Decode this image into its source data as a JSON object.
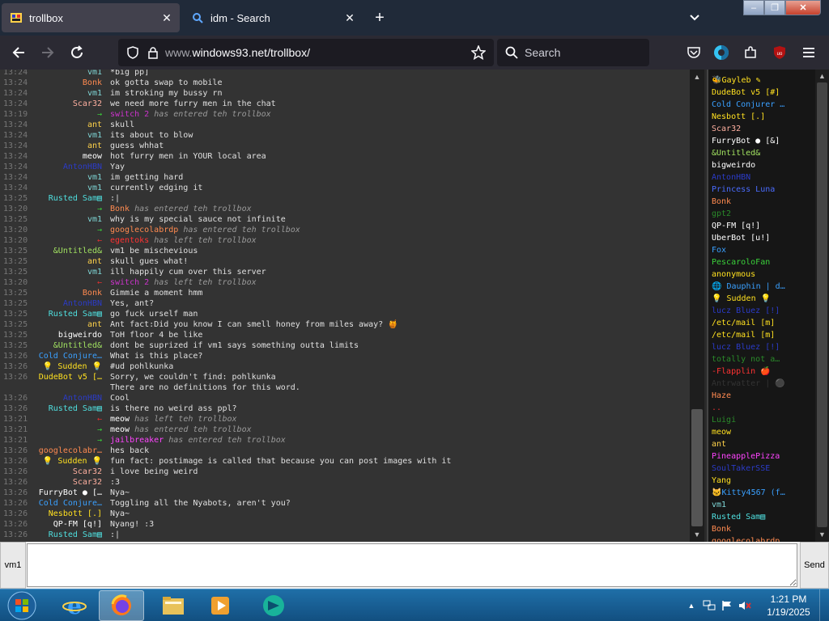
{
  "browser": {
    "tabs": [
      {
        "title": "trollbox",
        "active": true,
        "icon": "win93-icon"
      },
      {
        "title": "idm - Search",
        "active": false,
        "icon": "search-icon"
      }
    ],
    "url_dim": "www.",
    "url_main": "windows93.net/trollbox/",
    "search_placeholder": "Search"
  },
  "chat": {
    "messages": [
      {
        "time": "13:24",
        "nick": "vm1",
        "color": "#7fd7d7",
        "text": "*big pp]"
      },
      {
        "time": "13:24",
        "nick": "Bonk",
        "color": "#ff8a50",
        "text": "ok gotta swap to mobile"
      },
      {
        "time": "13:24",
        "nick": "vm1",
        "color": "#7fd7d7",
        "text": "im stroking my bussy rn"
      },
      {
        "time": "13:24",
        "nick": "Scar32",
        "color": "#ffb0a0",
        "text": "we need more furry men in the chat"
      },
      {
        "time": "13:19",
        "nick": "→",
        "color": "#3ad03a",
        "text": "has entered teh trollbox",
        "event": true,
        "ev_nick": "switch 2",
        "ev_color": "#cc33cc"
      },
      {
        "time": "13:24",
        "nick": "ant",
        "color": "#ffd24a",
        "text": "skull"
      },
      {
        "time": "13:24",
        "nick": "vm1",
        "color": "#7fd7d7",
        "text": "its about to blow"
      },
      {
        "time": "13:24",
        "nick": "ant",
        "color": "#ffd24a",
        "text": "guess whhat"
      },
      {
        "time": "13:24",
        "nick": "meow",
        "color": "#ffffff",
        "text": "hot furry men in YOUR local area"
      },
      {
        "time": "13:24",
        "nick": "AntonHBN",
        "color": "#2b3bc8",
        "text": "Yay"
      },
      {
        "time": "13:24",
        "nick": "vm1",
        "color": "#7fd7d7",
        "text": "im getting hard"
      },
      {
        "time": "13:24",
        "nick": "vm1",
        "color": "#7fd7d7",
        "text": "currently edging it"
      },
      {
        "time": "13:25",
        "nick": "Rusted Sam▤",
        "color": "#4fe0e0",
        "text": ":|"
      },
      {
        "time": "13:20",
        "nick": "→",
        "color": "#3ad03a",
        "text": "has entered teh trollbox",
        "event": true,
        "ev_nick": "Bonk",
        "ev_color": "#ff8a50"
      },
      {
        "time": "13:25",
        "nick": "vm1",
        "color": "#7fd7d7",
        "text": "why is my special sauce not infinite"
      },
      {
        "time": "13:20",
        "nick": "→",
        "color": "#3ad03a",
        "text": "has entered teh trollbox",
        "event": true,
        "ev_nick": "googlecolabrdp",
        "ev_color": "#ff8a50"
      },
      {
        "time": "13:20",
        "nick": "←",
        "color": "#e03030",
        "text": "has left teh trollbox",
        "event": true,
        "ev_nick": "egentoks",
        "ev_color": "#ff3333"
      },
      {
        "time": "13:25",
        "nick": "&Untitled&",
        "color": "#a0e060",
        "text": "vm1 be mischevious"
      },
      {
        "time": "13:25",
        "nick": "ant",
        "color": "#ffd24a",
        "text": "skull gues what!"
      },
      {
        "time": "13:25",
        "nick": "vm1",
        "color": "#7fd7d7",
        "text": "ill happily cum over this server"
      },
      {
        "time": "13:20",
        "nick": "←",
        "color": "#e03030",
        "text": "has left teh trollbox",
        "event": true,
        "ev_nick": "switch 2",
        "ev_color": "#cc33cc"
      },
      {
        "time": "13:25",
        "nick": "Bonk",
        "color": "#ff8a50",
        "text": "Gimmie a moment hmm"
      },
      {
        "time": "13:25",
        "nick": "AntonHBN",
        "color": "#2b3bc8",
        "text": "Yes, ant?"
      },
      {
        "time": "13:25",
        "nick": "Rusted Sam▤",
        "color": "#4fe0e0",
        "text": "go fuck urself man"
      },
      {
        "time": "13:25",
        "nick": "ant",
        "color": "#ffd24a",
        "text": "Ant fact:Did you know I can smell honey from miles away? 🍯"
      },
      {
        "time": "13:25",
        "nick": "bigweirdo",
        "color": "#ffffff",
        "text": "ToH floor 4 be like"
      },
      {
        "time": "13:25",
        "nick": "&Untitled&",
        "color": "#a0e060",
        "text": "dont be suprized if vm1 says something outta limits"
      },
      {
        "time": "13:26",
        "nick": "Cold Conjure…",
        "color": "#3aa0ff",
        "text": "What is this place?"
      },
      {
        "time": "13:26",
        "nick": "💡 Sudden 💡",
        "color": "#ffe020",
        "text": "#ud pohlkunka"
      },
      {
        "time": "13:26",
        "nick": "DudeBot v5 […",
        "color": "#ffe020",
        "text": "Sorry, we couldn't find: pohlkunka"
      },
      {
        "time": "",
        "nick": "",
        "color": "#ffffff",
        "text": "There are no definitions for this word."
      },
      {
        "time": "13:26",
        "nick": "AntonHBN",
        "color": "#2b3bc8",
        "text": "Cool"
      },
      {
        "time": "13:26",
        "nick": "Rusted Sam▤",
        "color": "#4fe0e0",
        "text": "is there no weird ass ppl?"
      },
      {
        "time": "13:21",
        "nick": "←",
        "color": "#e03030",
        "text": "has left teh trollbox",
        "event": true,
        "ev_nick": "meow",
        "ev_color": "#ffffff"
      },
      {
        "time": "13:21",
        "nick": "→",
        "color": "#3ad03a",
        "text": "has entered teh trollbox",
        "event": true,
        "ev_nick": "meow",
        "ev_color": "#ffffff"
      },
      {
        "time": "13:21",
        "nick": "→",
        "color": "#3ad03a",
        "text": "has entered teh trollbox",
        "event": true,
        "ev_nick": "jailbreaker",
        "ev_color": "#ff44ff"
      },
      {
        "time": "13:26",
        "nick": "googlecolabr…",
        "color": "#ff8a50",
        "text": "hes back"
      },
      {
        "time": "13:26",
        "nick": "💡 Sudden 💡",
        "color": "#ffe020",
        "text": "fun fact: postimage is called that because you can post images with it"
      },
      {
        "time": "13:26",
        "nick": "Scar32",
        "color": "#ffb0a0",
        "text": "i love being weird"
      },
      {
        "time": "13:26",
        "nick": "Scar32",
        "color": "#ffb0a0",
        "text": ":3"
      },
      {
        "time": "13:26",
        "nick": "FurryBot ● […",
        "color": "#ffffff",
        "text": "Nya~"
      },
      {
        "time": "13:26",
        "nick": "Cold Conjure…",
        "color": "#3aa0ff",
        "text": "Toggling all the Nyabots, aren't you?"
      },
      {
        "time": "13:26",
        "nick": "Nesbott [.]",
        "color": "#ffe020",
        "text": "Nya~"
      },
      {
        "time": "13:26",
        "nick": "QP-FM [q!]",
        "color": "#ffffff",
        "text": "Nyang! :3"
      },
      {
        "time": "13:26",
        "nick": "Rusted Sam▤",
        "color": "#4fe0e0",
        "text": ":|"
      }
    ]
  },
  "users": [
    {
      "name": "🐝Gayleb ✎",
      "color": "#ffe020"
    },
    {
      "name": "DudeBot v5 [#]",
      "color": "#ffe020"
    },
    {
      "name": "Cold Conjurer …",
      "color": "#3aa0ff"
    },
    {
      "name": "Nesbott [.]",
      "color": "#ffe020"
    },
    {
      "name": "Scar32",
      "color": "#ffb0a0"
    },
    {
      "name": "FurryBot ● [&]",
      "color": "#ffffff"
    },
    {
      "name": "&Untitled&",
      "color": "#a0e060"
    },
    {
      "name": "bigweirdo",
      "color": "#ffffff"
    },
    {
      "name": "AntonHBN",
      "color": "#2b3bc8"
    },
    {
      "name": "Princess Luna",
      "color": "#4a6cff"
    },
    {
      "name": "Bonk",
      "color": "#ff8a50"
    },
    {
      "name": "gpt2",
      "color": "#2a8a2a"
    },
    {
      "name": "QP-FM [q!]",
      "color": "#ffffff"
    },
    {
      "name": "UberBot [u!]",
      "color": "#ffffff"
    },
    {
      "name": "Fox",
      "color": "#3aa0ff"
    },
    {
      "name": "PescaroloFan",
      "color": "#3ad03a"
    },
    {
      "name": "anonymous",
      "color": "#ffe020"
    },
    {
      "name": "🌐 Dauphin | d…",
      "color": "#3aa0ff"
    },
    {
      "name": "💡 Sudden 💡",
      "color": "#ffe020"
    },
    {
      "name": "lucz Bluez [!]",
      "color": "#2b3bc8"
    },
    {
      "name": "/etc/mail [m]",
      "color": "#ffe020"
    },
    {
      "name": "/etc/mail [m]",
      "color": "#ffe020"
    },
    {
      "name": "lucz Bluez [!]",
      "color": "#2b3bc8"
    },
    {
      "name": "totally not a…",
      "color": "#2a8a2a"
    },
    {
      "name": "-Flapplin 🍎",
      "color": "#ff3333"
    },
    {
      "name": "Antrwatter | ⚫",
      "color": "#333333"
    },
    {
      "name": "Haze",
      "color": "#ff8a50"
    },
    {
      "name": "..",
      "color": "#e03030"
    },
    {
      "name": "Luigi",
      "color": "#2a8a2a"
    },
    {
      "name": "meow",
      "color": "#ffe020"
    },
    {
      "name": "ant",
      "color": "#ffd24a"
    },
    {
      "name": "PineapplePizza",
      "color": "#ff44ff"
    },
    {
      "name": "SoulTakerSSE",
      "color": "#2b3bc8"
    },
    {
      "name": "Yang",
      "color": "#ffe020"
    },
    {
      "name": "🐱Kitty4567 (f…",
      "color": "#3aa0ff"
    },
    {
      "name": "vm1",
      "color": "#7fd7d7"
    },
    {
      "name": "Rusted Sam▤",
      "color": "#4fe0e0"
    },
    {
      "name": "Bonk",
      "color": "#ff8a50"
    },
    {
      "name": "googlecolabrdp",
      "color": "#ff8a50"
    }
  ],
  "input": {
    "nick_label": "vm1",
    "value": "",
    "send_label": "Send"
  },
  "taskbar": {
    "time": "1:21 PM",
    "date": "1/19/2025",
    "apps": [
      "internet-explorer",
      "firefox",
      "file-explorer",
      "media-player",
      "app-icon"
    ]
  }
}
